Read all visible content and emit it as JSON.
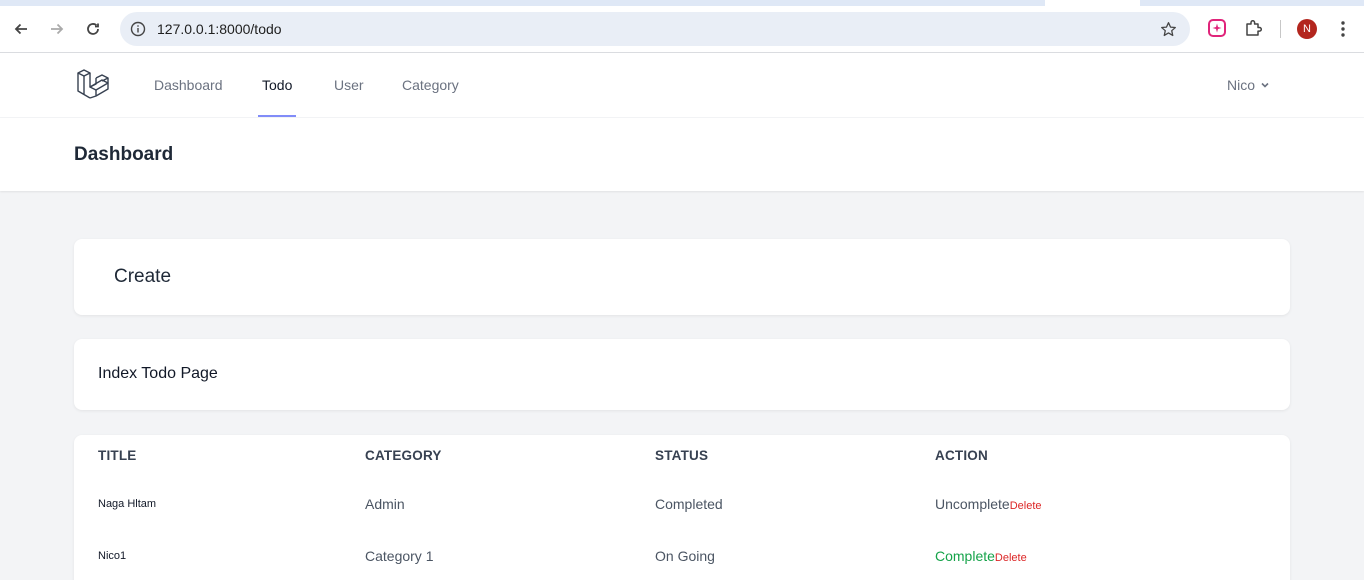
{
  "browser": {
    "url": "127.0.0.1:8000/todo",
    "profile_initial": "N",
    "icons": [
      "back-arrow-icon",
      "forward-arrow-icon",
      "reload-icon",
      "site-info-icon",
      "bookmark-star-icon",
      "extension-pink-icon",
      "puzzle-extensions-icon",
      "more-vert-icon"
    ]
  },
  "nav": {
    "items": [
      {
        "label": "Dashboard",
        "active": false
      },
      {
        "label": "Todo",
        "active": true
      },
      {
        "label": "User",
        "active": false
      },
      {
        "label": "Category",
        "active": false
      }
    ],
    "user": "Nico"
  },
  "header": {
    "title": "Dashboard"
  },
  "create": {
    "label": "Create"
  },
  "index": {
    "text": "Index Todo Page"
  },
  "table": {
    "columns": [
      "TITLE",
      "CATEGORY",
      "STATUS",
      "ACTION"
    ],
    "rows": [
      {
        "title": "Naga Hltam",
        "category": "Admin",
        "status": "Completed",
        "action": "Uncomplete",
        "action_color": "#4b5563",
        "delete": "Delete"
      },
      {
        "title": "Nico1",
        "category": "Category 1",
        "status": "On Going",
        "action": "Complete",
        "action_color": "#16a34a",
        "delete": "Delete"
      }
    ]
  },
  "colors": {
    "accent": "#818cf8",
    "delete": "#dc2626",
    "complete": "#16a34a",
    "avatar": "#b3261e"
  }
}
